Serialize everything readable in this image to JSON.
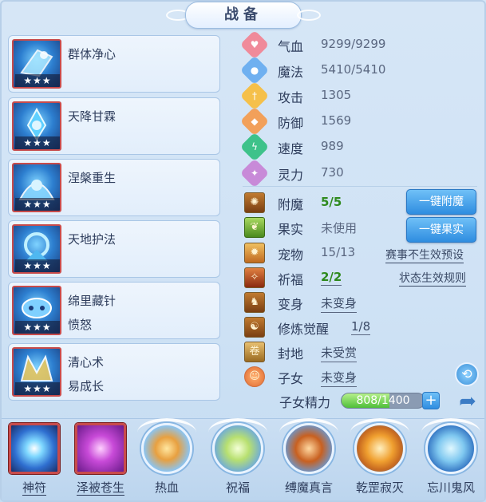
{
  "title": "战备",
  "skills": [
    {
      "name": "群体净心",
      "sub": "",
      "stars": "★★★",
      "color": "#3a7fd4"
    },
    {
      "name": "天降甘霖",
      "sub": "",
      "stars": "★★★",
      "color": "#2c6fc8"
    },
    {
      "name": "涅槃重生",
      "sub": "",
      "stars": "★★★",
      "color": "#3c82d0"
    },
    {
      "name": "天地护法",
      "sub": "",
      "stars": "★★★",
      "color": "#2f78cc"
    },
    {
      "name": "绵里藏针",
      "sub": "愤怒",
      "stars": "★★★",
      "color": "#3a6ec0"
    },
    {
      "name": "清心术",
      "sub": "易成长",
      "stars": "★★★",
      "color": "#2b5fae"
    }
  ],
  "stats": [
    {
      "icon": "heart-icon",
      "label": "气血",
      "value": "9299/9299",
      "color": "#f08a9a"
    },
    {
      "icon": "mana-icon",
      "label": "魔法",
      "value": "5410/5410",
      "color": "#6fb0f0"
    },
    {
      "icon": "sword-icon",
      "label": "攻击",
      "value": "1305",
      "color": "#f5c04a"
    },
    {
      "icon": "shield-icon",
      "label": "防御",
      "value": "1569",
      "color": "#f2a05a"
    },
    {
      "icon": "lightning-icon",
      "label": "速度",
      "value": "989",
      "color": "#3ec28a"
    },
    {
      "icon": "spirit-icon",
      "label": "灵力",
      "value": "730",
      "color": "#c88ad8"
    }
  ],
  "options": [
    {
      "icon": "enchant-icon",
      "label": "附魔",
      "value": "5/5",
      "style": "green"
    },
    {
      "icon": "fruit-icon",
      "label": "果实",
      "value": "未使用",
      "style": "plain"
    },
    {
      "icon": "pet-icon",
      "label": "宠物",
      "value": "15/13",
      "style": "plain"
    },
    {
      "icon": "blessing-icon",
      "label": "祈福",
      "value": "2/2",
      "style": "green-ul"
    },
    {
      "icon": "transform-icon",
      "label": "变身",
      "value": "未变身",
      "style": "ul"
    },
    {
      "icon": "cultivation-icon",
      "label": "修炼觉醒",
      "value": "1/8",
      "style": "ul-offset"
    },
    {
      "icon": "territory-icon",
      "label": "封地",
      "value": "未受赏",
      "style": "ul"
    },
    {
      "icon": "child-icon",
      "label": "子女",
      "value": "未变身",
      "style": "ul"
    }
  ],
  "buttons": {
    "enchant": "一键附魔",
    "fruit": "一键果实"
  },
  "links": {
    "preset": "赛事不生效预设",
    "rules": "状态生效规则"
  },
  "energy": {
    "label": "子女精力",
    "value": "808/1400",
    "current": 808,
    "max": 1400,
    "plus": "+"
  },
  "bottom_skills": [
    {
      "name": "神符",
      "kind": "square",
      "underlined": true
    },
    {
      "name": "泽被苍生",
      "kind": "square",
      "underlined": true
    },
    {
      "name": "热血",
      "kind": "round",
      "underlined": false
    },
    {
      "name": "祝福",
      "kind": "round",
      "underlined": false
    },
    {
      "name": "缚魔真言",
      "kind": "round",
      "underlined": false
    },
    {
      "name": "乾罡寂灭",
      "kind": "round",
      "underlined": false
    },
    {
      "name": "忘川鬼风",
      "kind": "round",
      "underlined": false
    }
  ]
}
